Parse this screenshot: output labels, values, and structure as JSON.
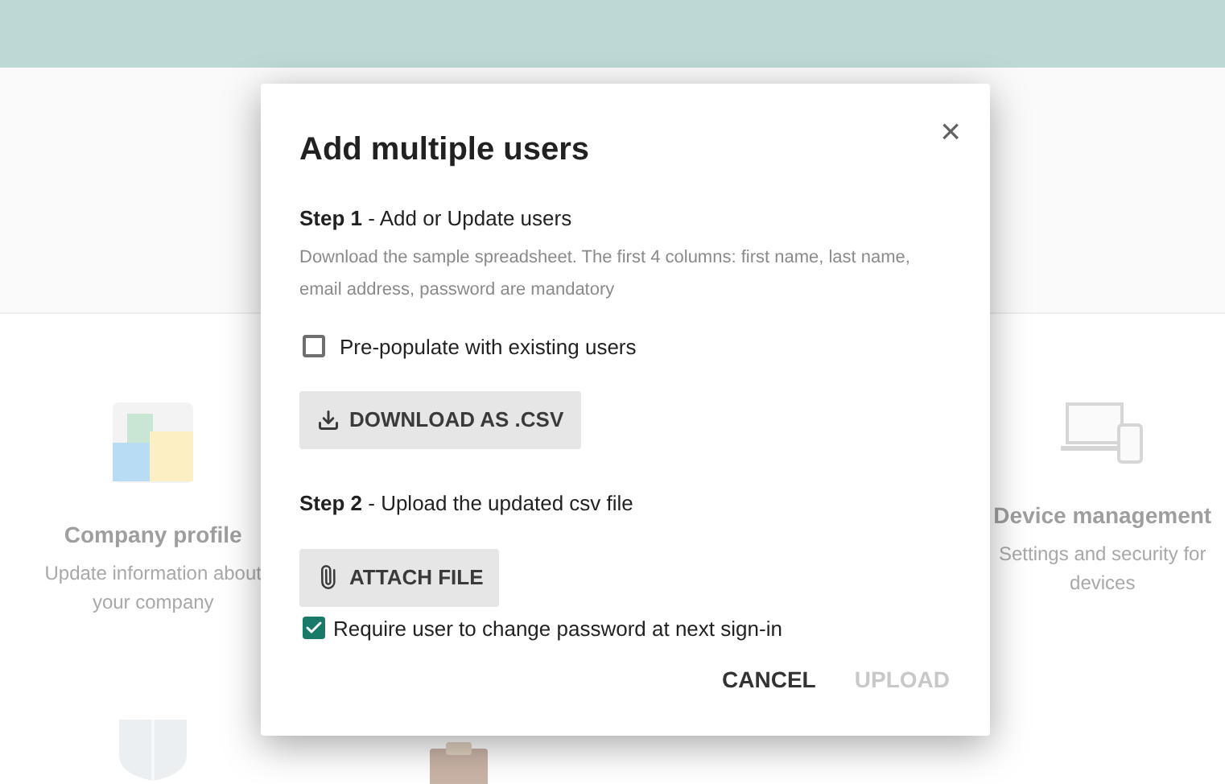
{
  "background_tiles": [
    {
      "kind": "company",
      "title": "Company profile",
      "description": "Update information about your company"
    },
    {
      "kind": "empty"
    },
    {
      "kind": "empty"
    },
    {
      "kind": "device",
      "title": "Device management",
      "description": "Settings and security for devices"
    },
    {
      "kind": "shield"
    },
    {
      "kind": "clipboard"
    }
  ],
  "dialog": {
    "title": "Add multiple users",
    "close": "×",
    "step1": {
      "heading": "**Step 1** - Add or Update users",
      "description": "Download the sample spreadsheet. The first 4 columns: first name, last name, email address, password are mandatory"
    },
    "prepopulate": {
      "label": "Pre-populate with existing users",
      "checked": false
    },
    "download_button": "DOWNLOAD AS .CSV",
    "step2": {
      "heading": "**Step 2** - Upload the updated csv file"
    },
    "attach_button": "ATTACH FILE",
    "require_change": {
      "label": "Require user to change password at next sign-in",
      "checked": true
    },
    "buttons": [
      {
        "label": "CANCEL",
        "disabled": false
      },
      {
        "label": "UPLOAD",
        "disabled": true
      }
    ]
  }
}
